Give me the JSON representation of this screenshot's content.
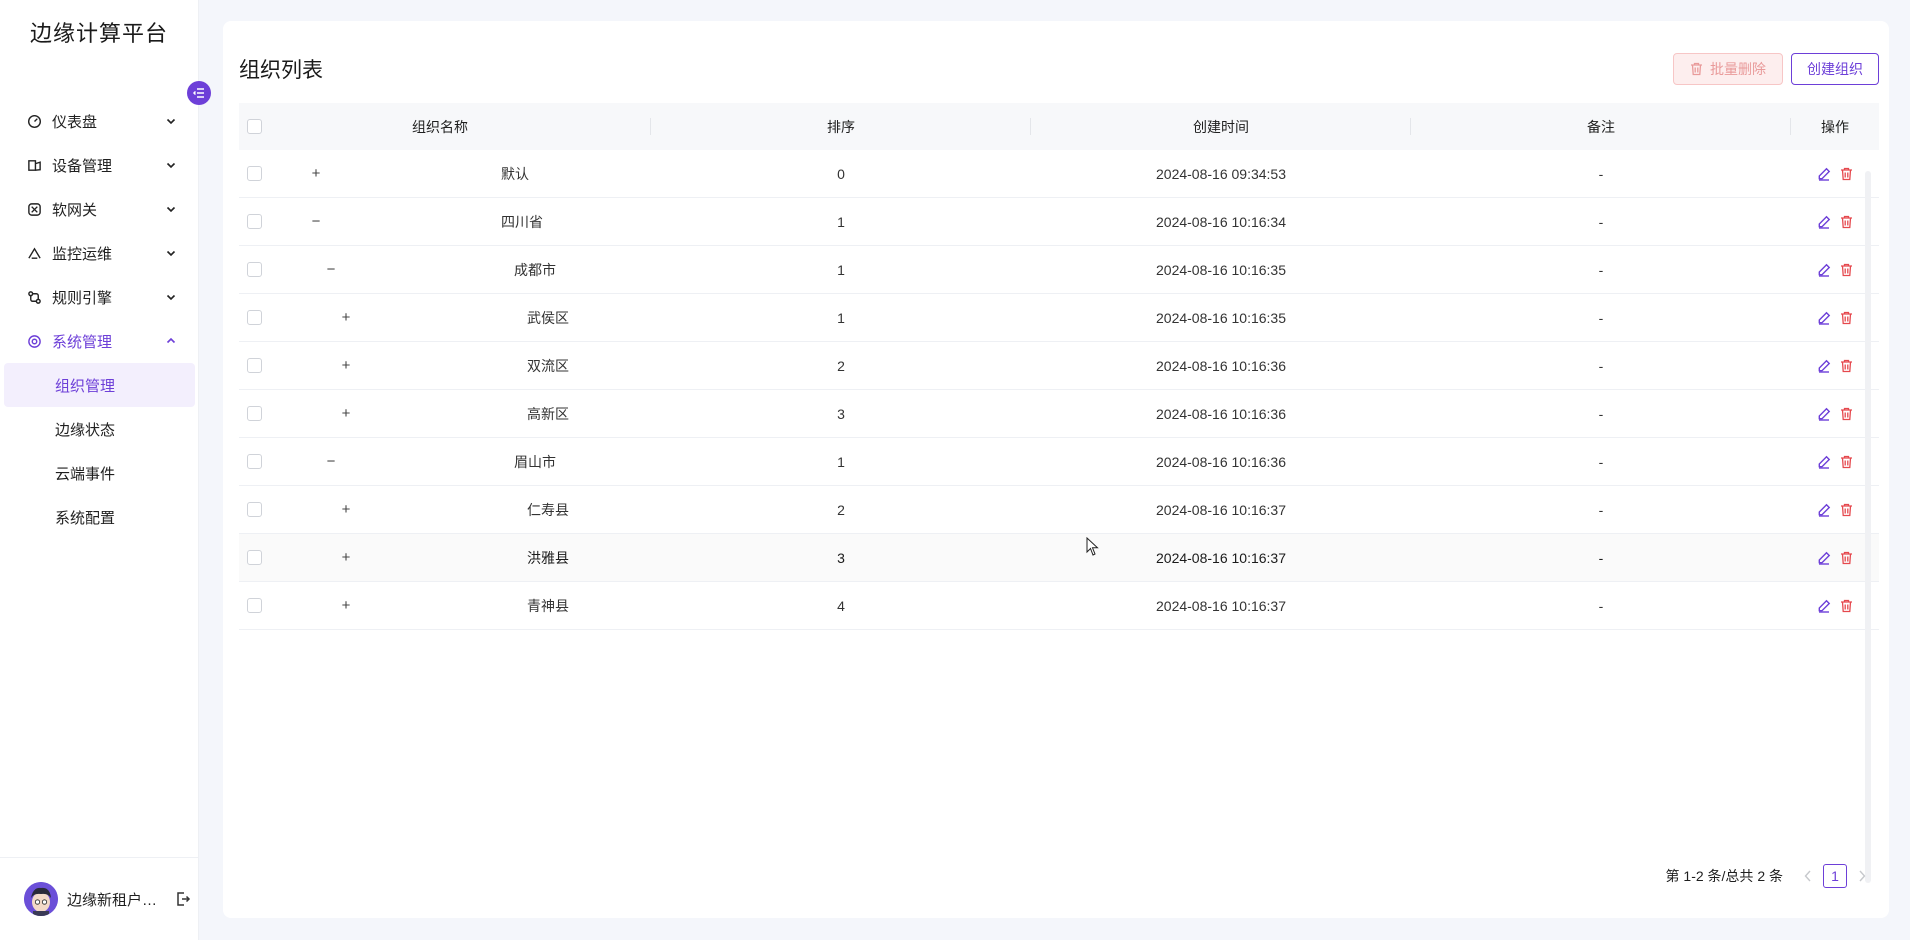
{
  "app": {
    "brand": "边缘计算平台"
  },
  "sidebar": {
    "menu": [
      {
        "label": "仪表盘",
        "icon": "dashboard-icon",
        "expanded": false
      },
      {
        "label": "设备管理",
        "icon": "device-icon",
        "expanded": false
      },
      {
        "label": "软网关",
        "icon": "gateway-icon",
        "expanded": false
      },
      {
        "label": "监控运维",
        "icon": "monitor-icon",
        "expanded": false
      },
      {
        "label": "规则引擎",
        "icon": "rule-icon",
        "expanded": false
      },
      {
        "label": "系统管理",
        "icon": "settings-icon",
        "expanded": true
      }
    ],
    "submenu": [
      {
        "label": "组织管理",
        "selected": true
      },
      {
        "label": "边缘状态",
        "selected": false
      },
      {
        "label": "云端事件",
        "selected": false
      },
      {
        "label": "系统配置",
        "selected": false
      }
    ],
    "user": {
      "name": "边缘新租户管理员"
    }
  },
  "main": {
    "title": "组织列表",
    "batch_delete_label": "批量删除",
    "create_label": "创建组织",
    "columns": [
      "组织名称",
      "排序",
      "创建时间",
      "备注",
      "操作"
    ],
    "rows": [
      {
        "name": "默认",
        "level": 0,
        "expander": "+",
        "sort": "0",
        "time": "2024-08-16 09:34:53",
        "note": "-"
      },
      {
        "name": "四川省",
        "level": 0,
        "expander": "−",
        "sort": "1",
        "time": "2024-08-16 10:16:34",
        "note": "-"
      },
      {
        "name": "成都市",
        "level": 1,
        "expander": "−",
        "sort": "1",
        "time": "2024-08-16 10:16:35",
        "note": "-"
      },
      {
        "name": "武侯区",
        "level": 2,
        "expander": "+",
        "sort": "1",
        "time": "2024-08-16 10:16:35",
        "note": "-"
      },
      {
        "name": "双流区",
        "level": 2,
        "expander": "+",
        "sort": "2",
        "time": "2024-08-16 10:16:36",
        "note": "-"
      },
      {
        "name": "高新区",
        "level": 2,
        "expander": "+",
        "sort": "3",
        "time": "2024-08-16 10:16:36",
        "note": "-"
      },
      {
        "name": "眉山市",
        "level": 1,
        "expander": "−",
        "sort": "1",
        "time": "2024-08-16 10:16:36",
        "note": "-"
      },
      {
        "name": "仁寿县",
        "level": 2,
        "expander": "+",
        "sort": "2",
        "time": "2024-08-16 10:16:37",
        "note": "-"
      },
      {
        "name": "洪雅县",
        "level": 2,
        "expander": "+",
        "sort": "3",
        "time": "2024-08-16 10:16:37",
        "note": "-",
        "hover": true
      },
      {
        "name": "青神县",
        "level": 2,
        "expander": "+",
        "sort": "4",
        "time": "2024-08-16 10:16:37",
        "note": "-"
      }
    ],
    "pagination": {
      "summary": "第 1-2 条/总共 2 条",
      "current_page": "1"
    }
  },
  "colors": {
    "primary": "#6d3fd8",
    "danger": "#e5484d",
    "danger_soft_bg": "#fdeeee"
  }
}
